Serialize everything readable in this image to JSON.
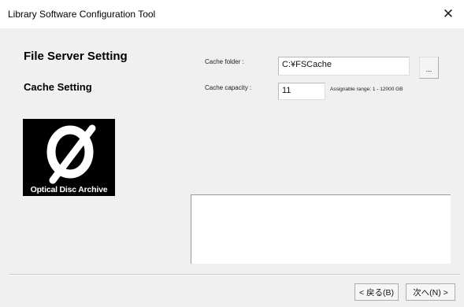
{
  "window": {
    "title": "Library Software Configuration Tool",
    "close_glyph": "✕"
  },
  "left_panel": {
    "heading_primary": "File Server Setting",
    "heading_secondary": "Cache Setting",
    "logo_text": "Optical Disc Archive",
    "logo_icon": "optical-disc-archive-logo"
  },
  "form": {
    "cache_folder": {
      "label": "Cache folder :",
      "value": "C:¥FSCache",
      "browse_label": "..."
    },
    "cache_capacity": {
      "label": "Cache capacity :",
      "value": "11",
      "range_note": "Assignable range: 1 - 12000 GB"
    }
  },
  "footer": {
    "back_label": "< 戻る(B)",
    "next_label": "次へ(N) >"
  }
}
